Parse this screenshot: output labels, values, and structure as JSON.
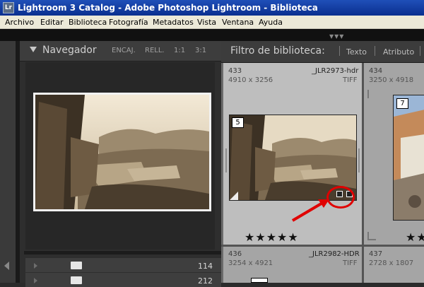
{
  "window": {
    "title": "Lightroom 3 Catalog - Adobe Photoshop Lightroom - Biblioteca",
    "icon_text": "Lr"
  },
  "menu": {
    "items": [
      "Archivo",
      "Editar",
      "Biblioteca",
      "Fotografía",
      "Metadatos",
      "Vista",
      "Ventana",
      "Ayuda"
    ]
  },
  "navigator": {
    "title": "Navegador",
    "options": [
      "ENCAJ.",
      "RELL.",
      "1:1",
      "3:1"
    ]
  },
  "folders": {
    "rows": [
      {
        "count": "114"
      },
      {
        "count": "212"
      }
    ]
  },
  "filter_bar": {
    "title": "Filtro de biblioteca:",
    "options": [
      "Texto",
      "Atributo"
    ]
  },
  "grid": {
    "cells": [
      {
        "index": "433",
        "file": "_JLR2973-hdr",
        "dims": "4910 x 3256",
        "type": "TIFF",
        "badge": "5",
        "rating": "★★★★★",
        "selected": true
      },
      {
        "index": "434",
        "file": "",
        "dims": "3250 x 4918",
        "type": "",
        "badge": "7",
        "rating": "★★",
        "selected": false
      },
      {
        "index": "436",
        "file": "_JLR2982-HDR",
        "dims": "3254 x 4921",
        "type": "TIFF",
        "badge": "",
        "rating": "",
        "selected": false
      },
      {
        "index": "437",
        "file": "",
        "dims": "2728 x 1807",
        "type": "",
        "badge": "",
        "rating": "",
        "selected": false
      }
    ]
  },
  "colors": {
    "title_bar": "#0a2f8f",
    "panel": "#2e2e2e",
    "selected_cell": "#bebebe",
    "annotation": "#e00000"
  }
}
